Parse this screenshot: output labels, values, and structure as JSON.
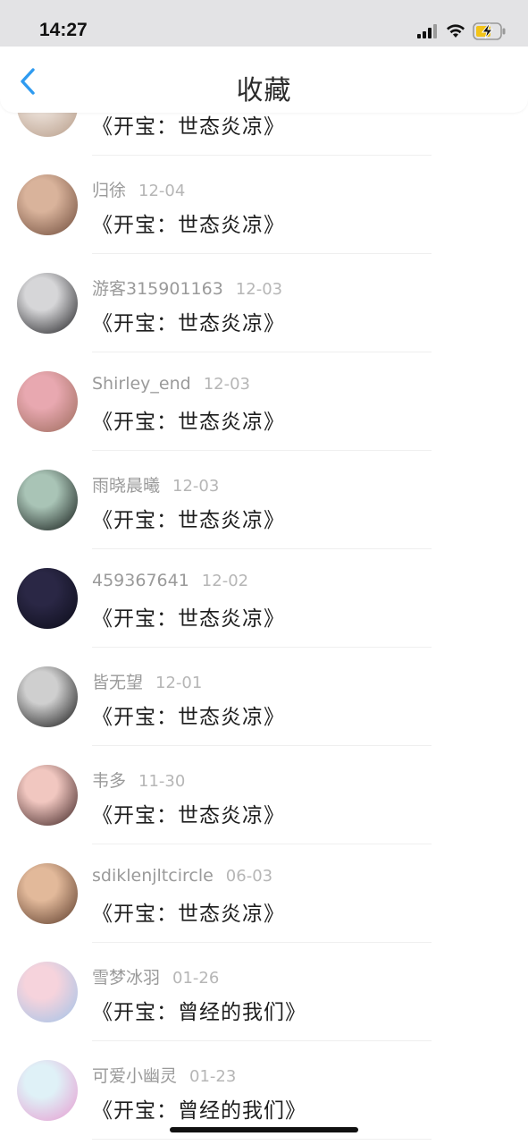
{
  "status_bar": {
    "time": "14:27",
    "icons": [
      "signal-icon",
      "wifi-icon",
      "battery-charging-icon"
    ]
  },
  "header": {
    "title": "收藏",
    "back_icon": "chevron-left-icon",
    "accent_color": "#2f9bf0"
  },
  "items": [
    {
      "user": "",
      "date": "",
      "title": "《开宝：世态炎凉》",
      "avatar_colors": [
        "#e9ddd4",
        "#b59a86"
      ]
    },
    {
      "user": "归徐",
      "date": "12-04",
      "title": "《开宝：世态炎凉》",
      "avatar_colors": [
        "#d9b39b",
        "#6d4a3a"
      ]
    },
    {
      "user": "游客315901163",
      "date": "12-03",
      "title": "《开宝：世态炎凉》",
      "avatar_colors": [
        "#d6d6d8",
        "#1c1c1f"
      ]
    },
    {
      "user": "Shirley_end",
      "date": "12-03",
      "title": "《开宝：世态炎凉》",
      "avatar_colors": [
        "#e8a8b0",
        "#9b6a5a"
      ]
    },
    {
      "user": "雨晓晨曦",
      "date": "12-03",
      "title": "《开宝：世态炎凉》",
      "avatar_colors": [
        "#a9c4b6",
        "#101614"
      ]
    },
    {
      "user": "459367641",
      "date": "12-02",
      "title": "《开宝：世态炎凉》",
      "avatar_colors": [
        "#2a2745",
        "#0b0c18"
      ]
    },
    {
      "user": "皆无望",
      "date": "12-01",
      "title": "《开宝：世态炎凉》",
      "avatar_colors": [
        "#cfcfcf",
        "#121212"
      ]
    },
    {
      "user": "韦多",
      "date": "11-30",
      "title": "《开宝：世态炎凉》",
      "avatar_colors": [
        "#f1c7c0",
        "#3a2020"
      ]
    },
    {
      "user": "sdiklenjltcircle",
      "date": "06-03",
      "title": "《开宝：世态炎凉》",
      "avatar_colors": [
        "#e2b99a",
        "#5a3a2a"
      ]
    },
    {
      "user": "雪梦冰羽",
      "date": "01-26",
      "title": "《开宝：曾经的我们》",
      "avatar_colors": [
        "#f6d3dc",
        "#9fc3e9"
      ]
    },
    {
      "user": "可爱小幽灵",
      "date": "01-23",
      "title": "《开宝：曾经的我们》",
      "avatar_colors": [
        "#dff1f7",
        "#e79ad0"
      ]
    }
  ]
}
